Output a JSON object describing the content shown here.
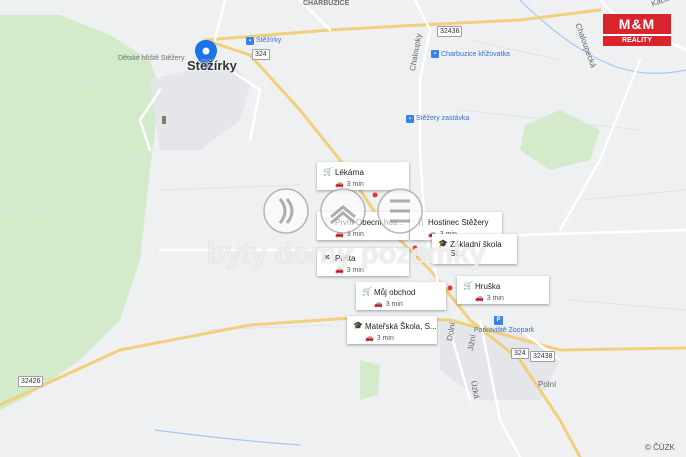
{
  "town": "Stěžírky",
  "places": {
    "detske_hriste": "Dětské hřiště Stěžery",
    "charbuzice": "CHARBUZICE",
    "charbuzice_krizovatka": "Charbuzice křižovatka",
    "stezery_zastavka": "Stěžery zastávka",
    "stezirky_bus": "Stěžírky",
    "parkoviste": "Parkoviště Zoopark"
  },
  "streets": {
    "chaloupky": "Chaloupky",
    "kacovska": "Kácovská",
    "chaloupecka": "Chaloupecká",
    "dolni": "Dolní",
    "jizni": "Jižní",
    "uzka": "Úzká",
    "polni": "Polní"
  },
  "shields": {
    "r324a": "324",
    "r324b": "324",
    "r32436": "32436",
    "r32438": "32438",
    "r32426": "32426"
  },
  "pois": [
    {
      "name": "Lékárna",
      "time": "3 min",
      "icon": "cart-icon"
    },
    {
      "name": "První Obecní hos...",
      "time": "3 min",
      "icon": "restaurant-icon"
    },
    {
      "name": "Hostinec Stěžery",
      "time": "3 min",
      "icon": "restaurant-icon"
    },
    {
      "name": "Základní škola St...",
      "time": "",
      "icon": "school-icon"
    },
    {
      "name": "Pošta",
      "time": "3 min",
      "icon": "post-icon"
    },
    {
      "name": "Můj obchod",
      "time": "3 min",
      "icon": "cart-icon"
    },
    {
      "name": "Hruška",
      "time": "3 min",
      "icon": "cart-icon"
    },
    {
      "name": "Mateřská Škola, S...",
      "time": "3 min",
      "icon": "school-icon"
    }
  ],
  "logo": {
    "top": "M&M",
    "bottom": "REALITY"
  },
  "watermark": "byty domy pozemky",
  "copyright": "© ČÚZK",
  "colors": {
    "land": "#eef0f2",
    "park": "#cfe8c4",
    "road": "#ffffff",
    "major_road": "#f4d58a",
    "pin": "#1a73e8",
    "logo": "#d9232d"
  }
}
